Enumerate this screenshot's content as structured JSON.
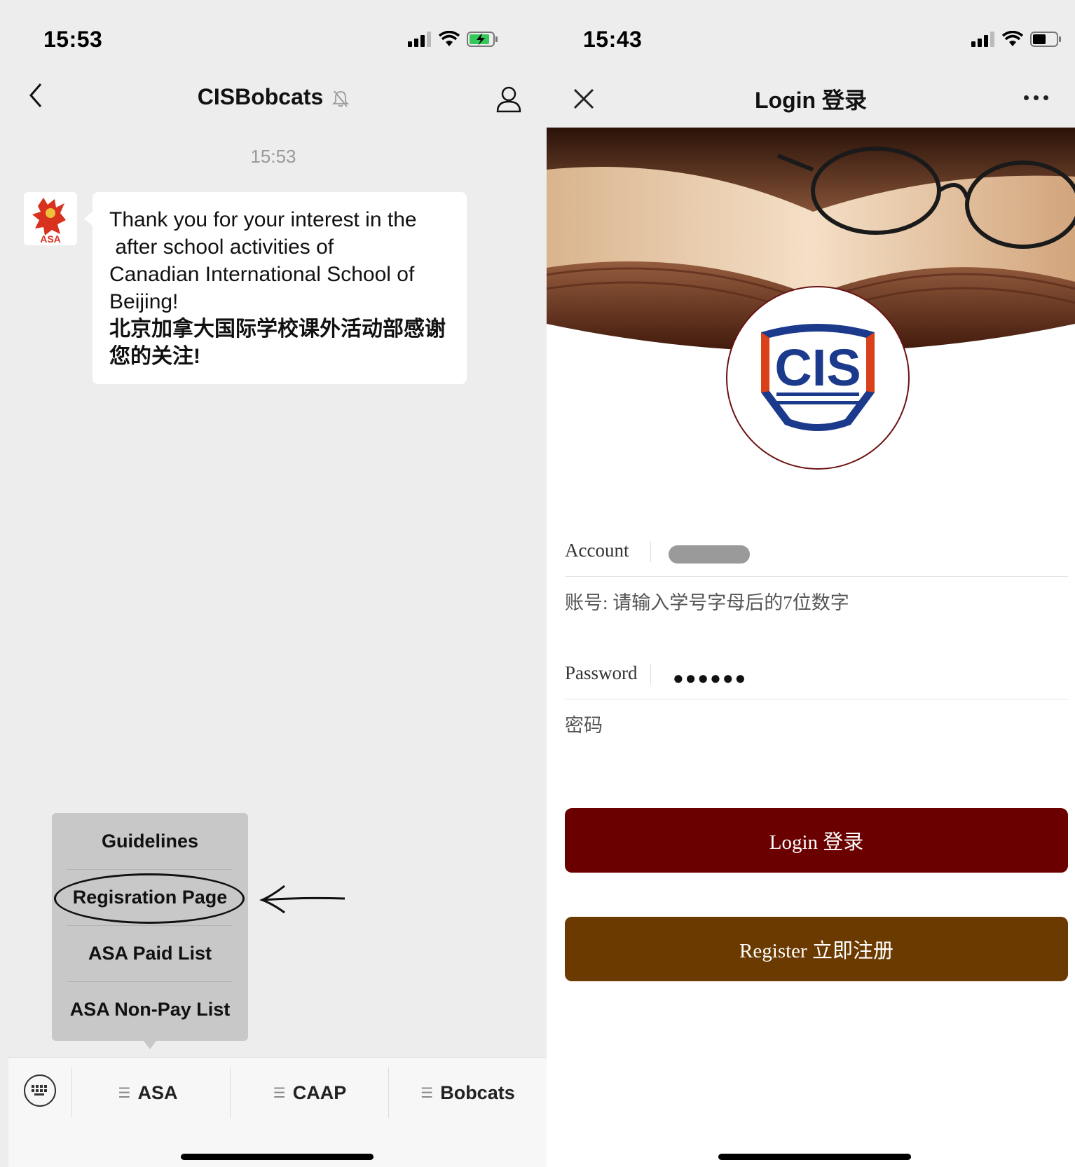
{
  "left": {
    "status": {
      "time": "15:53"
    },
    "nav": {
      "title": "CISBobcats"
    },
    "chat": {
      "timestamp": "15:53",
      "message_lines": [
        "Thank you for your interest in the",
        " after school activities of",
        "Canadian International School of",
        "Beijing!"
      ],
      "message_cn": "北京加拿大国际学校课外活动部感谢您的关注!"
    },
    "menu_popup": {
      "items": [
        "Guidelines",
        "Regisration Page",
        "ASA Paid List",
        "ASA Non-Pay List"
      ],
      "highlighted": "Regisration Page"
    },
    "bottom_menu": {
      "tabs": [
        "ASA",
        "CAAP",
        "Bobcats"
      ]
    },
    "colors": {
      "background": "#ededed",
      "bubble": "#ffffff",
      "popup": "#c8c8c8"
    }
  },
  "right": {
    "status": {
      "time": "15:43"
    },
    "nav": {
      "title": "Login 登录"
    },
    "logo_text": "CIS",
    "form": {
      "account_label": "Account",
      "account_hint": "账号: 请输入学号字母后的7位数字",
      "password_label": "Password",
      "password_value": "●●●●●●",
      "password_hint": "密码"
    },
    "buttons": {
      "login": "Login 登录",
      "register": "Register 立即注册"
    },
    "colors": {
      "login_button": "#6a0000",
      "register_button": "#6b3a00",
      "logo_blue": "#1c3a8c",
      "logo_red": "#d8411a"
    }
  }
}
